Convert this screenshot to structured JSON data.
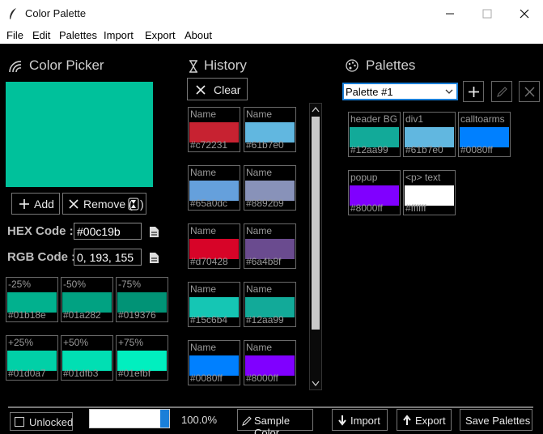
{
  "window": {
    "title": "Color Palette",
    "icon": "feather-icon"
  },
  "menu": [
    "File",
    "Edit",
    "Palettes",
    "Import",
    "Export",
    "About"
  ],
  "picker": {
    "title": "Color Picker",
    "icon": "rainbow-icon",
    "current_color": "#00c19b",
    "add_label": "Add",
    "remove_label": "Remove (",
    "hex_label": "HEX Code :",
    "hex_value": "#00c19b",
    "rgb_label": "RGB Code :",
    "rgb_value": "0, 193, 155",
    "shades": [
      {
        "label": "-25%",
        "hex": "#01b18e"
      },
      {
        "label": "-50%",
        "hex": "#01a282"
      },
      {
        "label": "-75%",
        "hex": "#019376"
      },
      {
        "label": "+25%",
        "hex": "#01d0a7"
      },
      {
        "label": "+50%",
        "hex": "#01dfb3"
      },
      {
        "label": "+75%",
        "hex": "#01efbf"
      }
    ]
  },
  "history": {
    "title": "History",
    "icon": "hourglass-icon",
    "clear_label": "Clear",
    "items": [
      {
        "name": "Name",
        "hex": "#c72231"
      },
      {
        "name": "Name",
        "hex": "#61b7e0"
      },
      {
        "name": "Name",
        "hex": "#65a0dc"
      },
      {
        "name": "Name",
        "hex": "#8892b9"
      },
      {
        "name": "Name",
        "hex": "#d70428"
      },
      {
        "name": "Name",
        "hex": "#6a4b8f"
      },
      {
        "name": "Name",
        "hex": "#15c6b4"
      },
      {
        "name": "Name",
        "hex": "#12aa99"
      },
      {
        "name": "Name",
        "hex": "#0080ff"
      },
      {
        "name": "Name",
        "hex": "#8000ff"
      }
    ]
  },
  "palettes": {
    "title": "Palettes",
    "icon": "palette-icon",
    "selected": "Palette #1",
    "items": [
      {
        "name": "header BG",
        "hex": "#12aa99"
      },
      {
        "name": "div1",
        "hex": "#61b7e0"
      },
      {
        "name": "calltoarms",
        "hex": "#0080ff"
      },
      {
        "name": "popup",
        "hex": "#8000ff"
      },
      {
        "name": "<p> text",
        "hex": "#ffffff"
      }
    ]
  },
  "footer": {
    "unlocked_label": "Unlocked",
    "zoom": "100.0%",
    "opacity_level": 1.0,
    "sample_label": "Sample Color",
    "import_label": "Import",
    "export_label": "Export",
    "save_label": "Save Palettes"
  }
}
